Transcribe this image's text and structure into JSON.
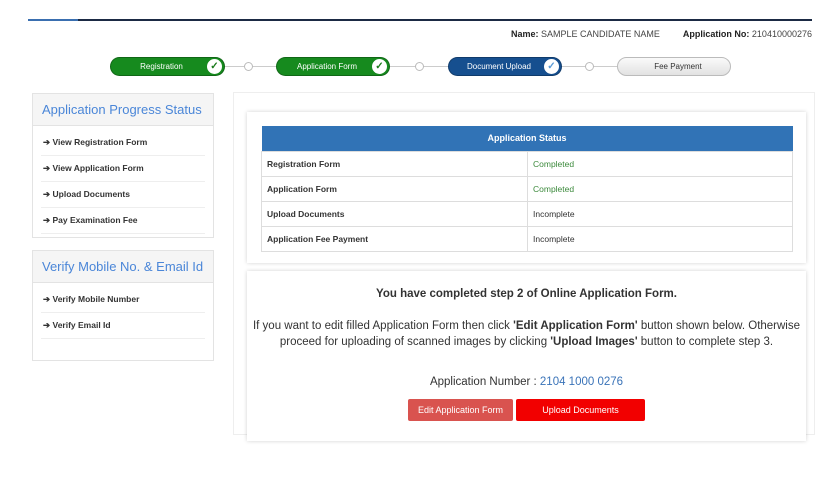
{
  "header": {
    "name_label": "Name:",
    "name_value": "SAMPLE CANDIDATE NAME",
    "appno_label": "Application No:",
    "appno_value": "210410000276"
  },
  "steps": [
    {
      "label": "Registration",
      "status": "completed"
    },
    {
      "label": "Application Form",
      "status": "completed"
    },
    {
      "label": "Document Upload",
      "status": "current"
    },
    {
      "label": "Fee Payment",
      "status": "pending"
    }
  ],
  "check_glyph": "✓",
  "sidebar": {
    "progress": {
      "title": "Application Progress Status",
      "items": [
        "View Registration Form",
        "View Application Form",
        "Upload Documents",
        "Pay Examination Fee"
      ]
    },
    "verify": {
      "title": "Verify Mobile No. & Email Id",
      "items": [
        "Verify Mobile Number",
        "Verify Email Id"
      ]
    },
    "arrow": "➔"
  },
  "status_table": {
    "title": "Application Status",
    "rows": [
      {
        "item": "Registration Form",
        "status": "Completed"
      },
      {
        "item": "Application Form",
        "status": "Completed"
      },
      {
        "item": "Upload Documents",
        "status": "Incomplete"
      },
      {
        "item": "Application Fee Payment",
        "status": "Incomplete"
      }
    ]
  },
  "message": {
    "heading": "You have completed step 2 of Online Application Form.",
    "p1": "If you want to edit filled Application Form then click ",
    "b1": "'Edit Application Form'",
    "p2": " button shown below. Otherwise proceed for uploading of scanned images by clicking ",
    "b2": "'Upload Images'",
    "p3": " button to complete step 3.",
    "appnum_label": "Application Number : ",
    "appnum_value": "2104 1000 0276"
  },
  "buttons": {
    "edit": "Edit Application Form",
    "upload": "Upload Documents"
  },
  "colors": {
    "green": "#168a1e",
    "blue": "#164f8f",
    "table_header": "#3173b6",
    "upload_btn": "#f20000",
    "edit_btn": "#d9534f"
  }
}
